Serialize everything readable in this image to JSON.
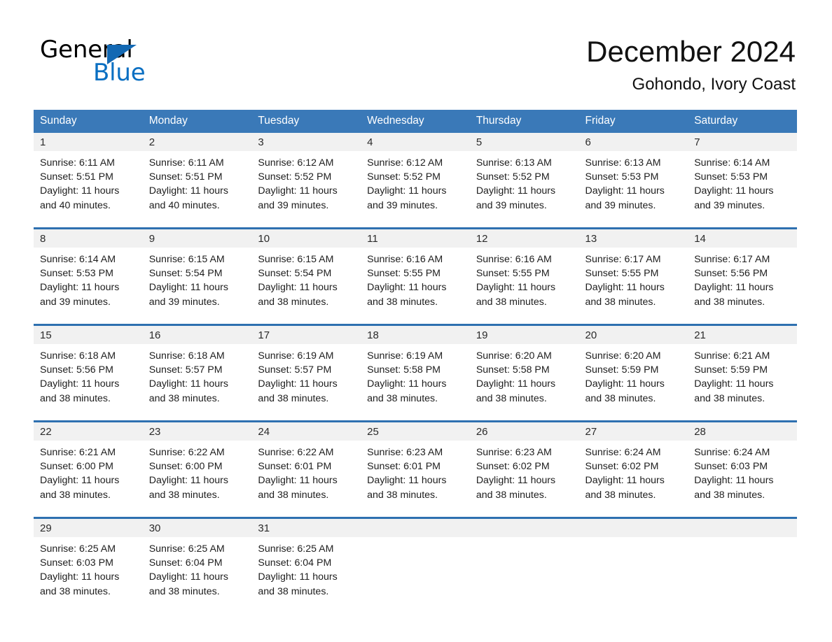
{
  "logo": {
    "word_one": "General",
    "word_two": "Blue",
    "triangle_icon": "blue-triangle-icon",
    "brand_blue": "#0a6fc2"
  },
  "header": {
    "title": "December 2024",
    "subtitle": "Gohondo, Ivory Coast"
  },
  "colors": {
    "header_blue": "#3a79b8",
    "rule_blue": "#2e70b0",
    "daynum_band": "#f1f1f1",
    "text": "#1d1d1d"
  },
  "weekdays": [
    "Sunday",
    "Monday",
    "Tuesday",
    "Wednesday",
    "Thursday",
    "Friday",
    "Saturday"
  ],
  "weeks": [
    [
      {
        "day": "1",
        "sunrise": "Sunrise: 6:11 AM",
        "sunset": "Sunset: 5:51 PM",
        "daylight_line1": "Daylight: 11 hours",
        "daylight_line2": "and 40 minutes."
      },
      {
        "day": "2",
        "sunrise": "Sunrise: 6:11 AM",
        "sunset": "Sunset: 5:51 PM",
        "daylight_line1": "Daylight: 11 hours",
        "daylight_line2": "and 40 minutes."
      },
      {
        "day": "3",
        "sunrise": "Sunrise: 6:12 AM",
        "sunset": "Sunset: 5:52 PM",
        "daylight_line1": "Daylight: 11 hours",
        "daylight_line2": "and 39 minutes."
      },
      {
        "day": "4",
        "sunrise": "Sunrise: 6:12 AM",
        "sunset": "Sunset: 5:52 PM",
        "daylight_line1": "Daylight: 11 hours",
        "daylight_line2": "and 39 minutes."
      },
      {
        "day": "5",
        "sunrise": "Sunrise: 6:13 AM",
        "sunset": "Sunset: 5:52 PM",
        "daylight_line1": "Daylight: 11 hours",
        "daylight_line2": "and 39 minutes."
      },
      {
        "day": "6",
        "sunrise": "Sunrise: 6:13 AM",
        "sunset": "Sunset: 5:53 PM",
        "daylight_line1": "Daylight: 11 hours",
        "daylight_line2": "and 39 minutes."
      },
      {
        "day": "7",
        "sunrise": "Sunrise: 6:14 AM",
        "sunset": "Sunset: 5:53 PM",
        "daylight_line1": "Daylight: 11 hours",
        "daylight_line2": "and 39 minutes."
      }
    ],
    [
      {
        "day": "8",
        "sunrise": "Sunrise: 6:14 AM",
        "sunset": "Sunset: 5:53 PM",
        "daylight_line1": "Daylight: 11 hours",
        "daylight_line2": "and 39 minutes."
      },
      {
        "day": "9",
        "sunrise": "Sunrise: 6:15 AM",
        "sunset": "Sunset: 5:54 PM",
        "daylight_line1": "Daylight: 11 hours",
        "daylight_line2": "and 39 minutes."
      },
      {
        "day": "10",
        "sunrise": "Sunrise: 6:15 AM",
        "sunset": "Sunset: 5:54 PM",
        "daylight_line1": "Daylight: 11 hours",
        "daylight_line2": "and 38 minutes."
      },
      {
        "day": "11",
        "sunrise": "Sunrise: 6:16 AM",
        "sunset": "Sunset: 5:55 PM",
        "daylight_line1": "Daylight: 11 hours",
        "daylight_line2": "and 38 minutes."
      },
      {
        "day": "12",
        "sunrise": "Sunrise: 6:16 AM",
        "sunset": "Sunset: 5:55 PM",
        "daylight_line1": "Daylight: 11 hours",
        "daylight_line2": "and 38 minutes."
      },
      {
        "day": "13",
        "sunrise": "Sunrise: 6:17 AM",
        "sunset": "Sunset: 5:55 PM",
        "daylight_line1": "Daylight: 11 hours",
        "daylight_line2": "and 38 minutes."
      },
      {
        "day": "14",
        "sunrise": "Sunrise: 6:17 AM",
        "sunset": "Sunset: 5:56 PM",
        "daylight_line1": "Daylight: 11 hours",
        "daylight_line2": "and 38 minutes."
      }
    ],
    [
      {
        "day": "15",
        "sunrise": "Sunrise: 6:18 AM",
        "sunset": "Sunset: 5:56 PM",
        "daylight_line1": "Daylight: 11 hours",
        "daylight_line2": "and 38 minutes."
      },
      {
        "day": "16",
        "sunrise": "Sunrise: 6:18 AM",
        "sunset": "Sunset: 5:57 PM",
        "daylight_line1": "Daylight: 11 hours",
        "daylight_line2": "and 38 minutes."
      },
      {
        "day": "17",
        "sunrise": "Sunrise: 6:19 AM",
        "sunset": "Sunset: 5:57 PM",
        "daylight_line1": "Daylight: 11 hours",
        "daylight_line2": "and 38 minutes."
      },
      {
        "day": "18",
        "sunrise": "Sunrise: 6:19 AM",
        "sunset": "Sunset: 5:58 PM",
        "daylight_line1": "Daylight: 11 hours",
        "daylight_line2": "and 38 minutes."
      },
      {
        "day": "19",
        "sunrise": "Sunrise: 6:20 AM",
        "sunset": "Sunset: 5:58 PM",
        "daylight_line1": "Daylight: 11 hours",
        "daylight_line2": "and 38 minutes."
      },
      {
        "day": "20",
        "sunrise": "Sunrise: 6:20 AM",
        "sunset": "Sunset: 5:59 PM",
        "daylight_line1": "Daylight: 11 hours",
        "daylight_line2": "and 38 minutes."
      },
      {
        "day": "21",
        "sunrise": "Sunrise: 6:21 AM",
        "sunset": "Sunset: 5:59 PM",
        "daylight_line1": "Daylight: 11 hours",
        "daylight_line2": "and 38 minutes."
      }
    ],
    [
      {
        "day": "22",
        "sunrise": "Sunrise: 6:21 AM",
        "sunset": "Sunset: 6:00 PM",
        "daylight_line1": "Daylight: 11 hours",
        "daylight_line2": "and 38 minutes."
      },
      {
        "day": "23",
        "sunrise": "Sunrise: 6:22 AM",
        "sunset": "Sunset: 6:00 PM",
        "daylight_line1": "Daylight: 11 hours",
        "daylight_line2": "and 38 minutes."
      },
      {
        "day": "24",
        "sunrise": "Sunrise: 6:22 AM",
        "sunset": "Sunset: 6:01 PM",
        "daylight_line1": "Daylight: 11 hours",
        "daylight_line2": "and 38 minutes."
      },
      {
        "day": "25",
        "sunrise": "Sunrise: 6:23 AM",
        "sunset": "Sunset: 6:01 PM",
        "daylight_line1": "Daylight: 11 hours",
        "daylight_line2": "and 38 minutes."
      },
      {
        "day": "26",
        "sunrise": "Sunrise: 6:23 AM",
        "sunset": "Sunset: 6:02 PM",
        "daylight_line1": "Daylight: 11 hours",
        "daylight_line2": "and 38 minutes."
      },
      {
        "day": "27",
        "sunrise": "Sunrise: 6:24 AM",
        "sunset": "Sunset: 6:02 PM",
        "daylight_line1": "Daylight: 11 hours",
        "daylight_line2": "and 38 minutes."
      },
      {
        "day": "28",
        "sunrise": "Sunrise: 6:24 AM",
        "sunset": "Sunset: 6:03 PM",
        "daylight_line1": "Daylight: 11 hours",
        "daylight_line2": "and 38 minutes."
      }
    ],
    [
      {
        "day": "29",
        "sunrise": "Sunrise: 6:25 AM",
        "sunset": "Sunset: 6:03 PM",
        "daylight_line1": "Daylight: 11 hours",
        "daylight_line2": "and 38 minutes."
      },
      {
        "day": "30",
        "sunrise": "Sunrise: 6:25 AM",
        "sunset": "Sunset: 6:04 PM",
        "daylight_line1": "Daylight: 11 hours",
        "daylight_line2": "and 38 minutes."
      },
      {
        "day": "31",
        "sunrise": "Sunrise: 6:25 AM",
        "sunset": "Sunset: 6:04 PM",
        "daylight_line1": "Daylight: 11 hours",
        "daylight_line2": "and 38 minutes."
      },
      {
        "day": "",
        "sunrise": "",
        "sunset": "",
        "daylight_line1": "",
        "daylight_line2": ""
      },
      {
        "day": "",
        "sunrise": "",
        "sunset": "",
        "daylight_line1": "",
        "daylight_line2": ""
      },
      {
        "day": "",
        "sunrise": "",
        "sunset": "",
        "daylight_line1": "",
        "daylight_line2": ""
      },
      {
        "day": "",
        "sunrise": "",
        "sunset": "",
        "daylight_line1": "",
        "daylight_line2": ""
      }
    ]
  ]
}
